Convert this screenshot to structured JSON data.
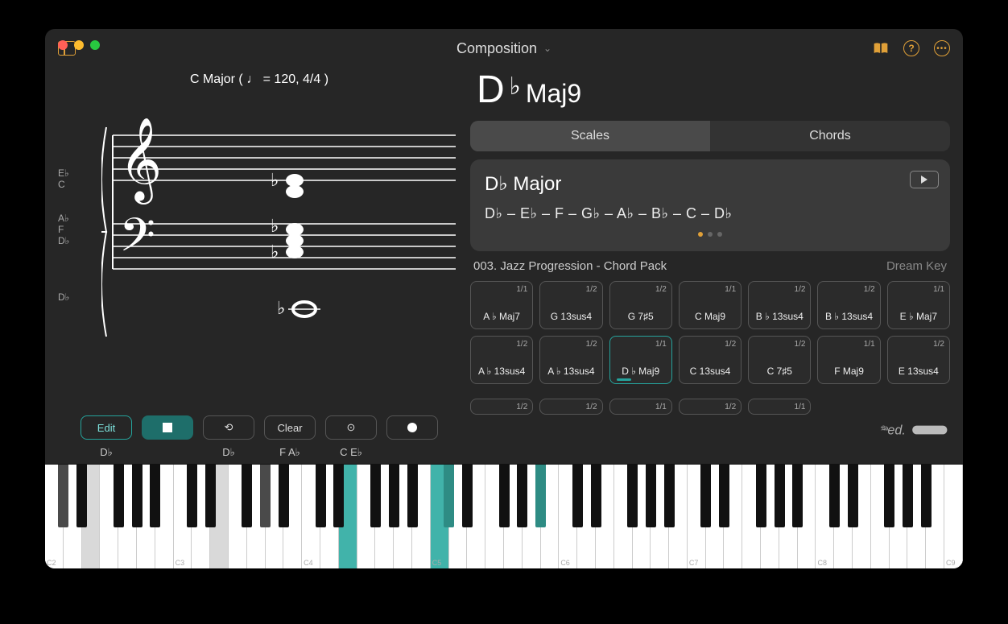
{
  "header": {
    "title": "Composition"
  },
  "staff": {
    "key_label": "C Major ( ♩ = 120, 4/4 )",
    "treble_note_names": [
      "E♭",
      "C"
    ],
    "bass_note_names": [
      "A♭",
      "F",
      "D♭"
    ],
    "extra_note": "D♭"
  },
  "chord_display": {
    "root": "D",
    "accidental": "♭",
    "quality": "Maj9"
  },
  "segmented": {
    "scales": "Scales",
    "chords": "Chords",
    "active": "scales"
  },
  "scale_card": {
    "name": "D♭ Major",
    "notes": "D♭ – E♭ – F – G♭ – A♭ – B♭ – C – D♭",
    "page_count": 3,
    "active_page": 0
  },
  "pack": {
    "title": "003. Jazz Progression - Chord Pack",
    "brand": "Dream Key"
  },
  "chord_cards": [
    {
      "dur": "1/1",
      "label": "A ♭ Maj7"
    },
    {
      "dur": "1/2",
      "label": "G 13sus4"
    },
    {
      "dur": "1/2",
      "label": "G 7♯5"
    },
    {
      "dur": "1/1",
      "label": "C Maj9"
    },
    {
      "dur": "1/2",
      "label": "B ♭ 13sus4"
    },
    {
      "dur": "1/2",
      "label": "B ♭ 13sus4"
    },
    {
      "dur": "1/1",
      "label": "E ♭ Maj7"
    },
    {
      "dur": "1/2",
      "label": "A ♭ 13sus4"
    },
    {
      "dur": "1/2",
      "label": "A ♭ 13sus4"
    },
    {
      "dur": "1/1",
      "label": "D ♭ Maj9",
      "selected": true
    },
    {
      "dur": "1/2",
      "label": "C 13sus4"
    },
    {
      "dur": "1/2",
      "label": "C 7♯5"
    },
    {
      "dur": "1/1",
      "label": "F Maj9"
    },
    {
      "dur": "1/2",
      "label": "E 13sus4"
    }
  ],
  "chord_cards_truncated": [
    {
      "dur": "1/2"
    },
    {
      "dur": "1/2"
    },
    {
      "dur": "1/1"
    },
    {
      "dur": "1/2"
    },
    {
      "dur": "1/1"
    }
  ],
  "toolbar": {
    "edit": "Edit",
    "clear": "Clear",
    "labels": [
      "D♭",
      "",
      "D♭",
      "F   A♭",
      "C   E♭",
      ""
    ]
  },
  "piano": {
    "octave_labels": [
      "C2",
      "C3",
      "C4",
      "C5",
      "C6",
      "C7",
      "C8",
      "C9"
    ],
    "white_pressed_indices": [
      16,
      21
    ],
    "white_dim_indices": [
      2,
      9
    ],
    "black_pressed_positions": [
      15,
      19
    ],
    "black_dim_positions": [
      0,
      8
    ]
  }
}
